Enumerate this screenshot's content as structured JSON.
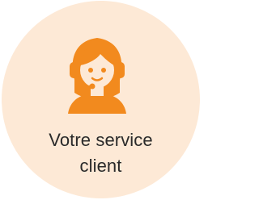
{
  "badge": {
    "icon": "customer-service-agent-headset-icon",
    "line1": "Votre service",
    "line2": "client",
    "colors": {
      "background": "#fde9d6",
      "accent": "#f28a1e",
      "text": "#2a2a2a"
    }
  }
}
